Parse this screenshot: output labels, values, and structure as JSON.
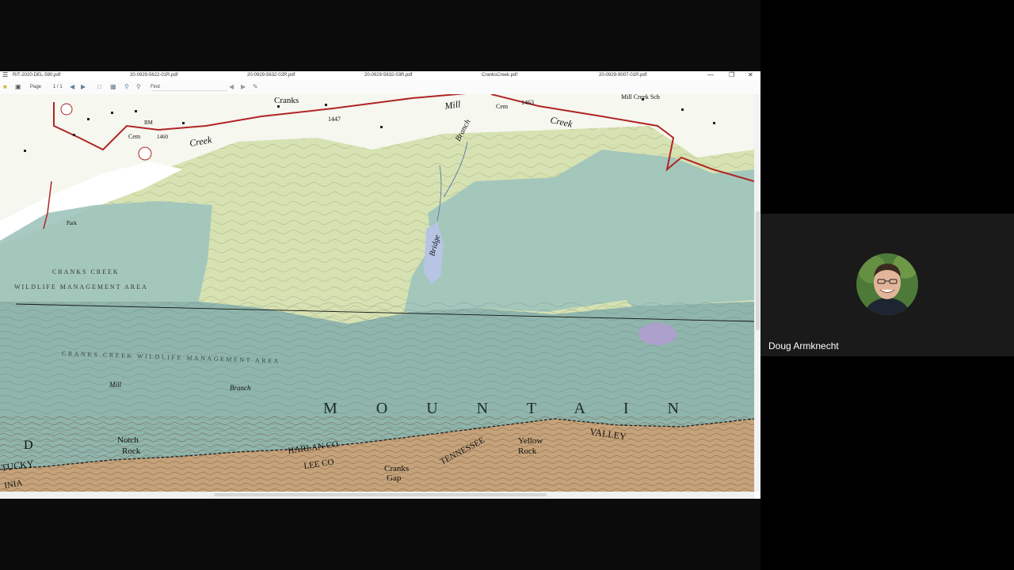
{
  "viewer": {
    "tabs": [
      "RIT-2020-DEL-590.pdf",
      "20-0929-5622-01R.pdf",
      "20-0929-5632-02R.pdf",
      "20-0929-5632-03R.pdf",
      "CranksCreek.pdf",
      "20-0929-9007-01R.pdf"
    ],
    "toolbar": {
      "page_label": "Page",
      "page_value": "1 / 1",
      "find_label": "Find"
    }
  },
  "map": {
    "labels": {
      "cranks": "Cranks",
      "mill_top": "Mill",
      "creek_left": "Creek",
      "creek_right": "Creek",
      "branch_top": "Branch",
      "bridge": "Bridge",
      "mill_creek_sch": "Mill Creek Sch",
      "park": "Park",
      "wma1_line1": "CRANKS CREEK",
      "wma1_line2": "WILDLIFE MANAGEMENT AREA",
      "wma2": "CRANKS CREEK WILDLIFE MANAGEMENT AREA",
      "mill_lower": "Mill",
      "branch_lower": "Branch",
      "mountain": "M O U N T A I N",
      "notch_rock_1": "Notch",
      "notch_rock_2": "Rock",
      "harlan": "HARLAN CO",
      "lee": "LEE  CO",
      "cranks_gap_1": "Cranks",
      "cranks_gap_2": "Gap",
      "tennessee": "TENNESSEE",
      "yellow_rock_1": "Yellow",
      "yellow_rock_2": "Rock",
      "valley": "VALLEY",
      "d": "D",
      "tucky": "TUCKY",
      "inia": "INIA",
      "elev_1447": "1447",
      "elev_1463": "1463",
      "elev_1460": "1460",
      "bm": "BM",
      "cem1": "Cem",
      "cem2": "Cem"
    }
  },
  "participant": {
    "name": "Doug Armknecht"
  }
}
